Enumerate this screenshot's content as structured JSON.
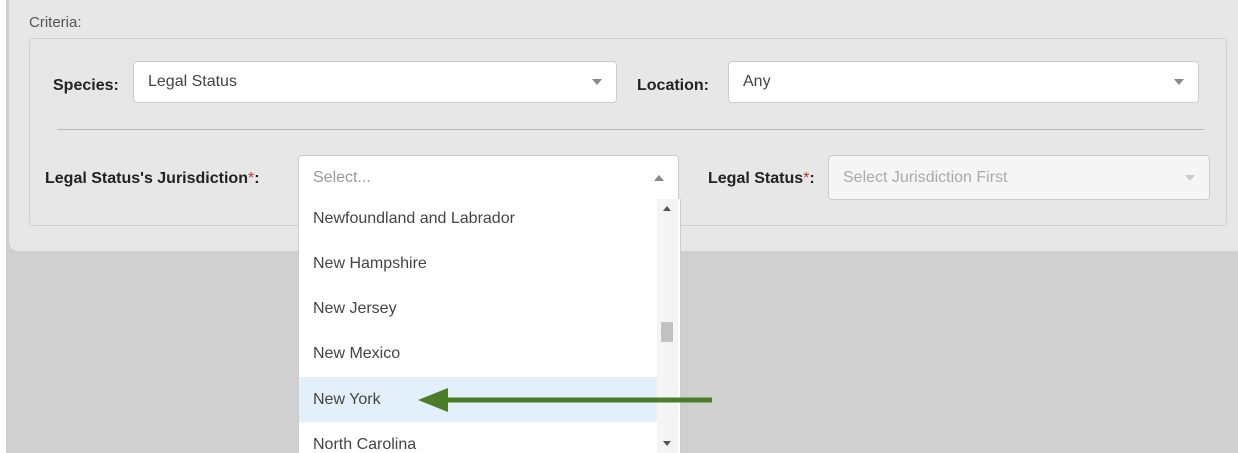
{
  "criteria": {
    "label": "Criteria:"
  },
  "species": {
    "label": "Species:",
    "value": "Legal Status"
  },
  "location": {
    "label": "Location:",
    "value": "Any"
  },
  "jurisdiction": {
    "label": "Legal Status's Jurisdiction",
    "required_mark": "*",
    "colon": ":",
    "placeholder": "Select..."
  },
  "legal_status": {
    "label": "Legal Status",
    "required_mark": "*",
    "colon": ":",
    "placeholder": "Select Jurisdiction First"
  },
  "dropdown": {
    "options": [
      "Newfoundland and Labrador",
      "New Hampshire",
      "New Jersey",
      "New Mexico",
      "New York",
      "North Carolina"
    ],
    "highlighted": "New York"
  },
  "colors": {
    "arrow": "#4a7c2a",
    "highlight": "#e3f0fb",
    "required": "#c0392b"
  },
  "icons": [
    "chevron-down-icon",
    "chevron-up-icon",
    "scroll-up-icon",
    "scroll-down-icon",
    "arrow-left-icon"
  ]
}
